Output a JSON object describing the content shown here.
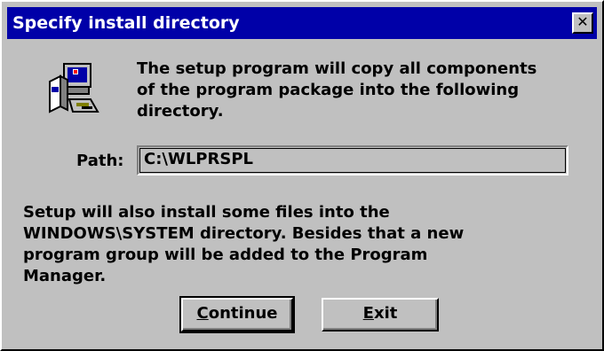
{
  "window": {
    "title": "Specify install directory",
    "close_glyph": "✕"
  },
  "icons": {
    "setup": "setup-computer-icon",
    "close": "close-icon"
  },
  "intro": {
    "line1": "The setup program will copy all components",
    "line2": "of the program package into the following",
    "line3": "directory."
  },
  "path": {
    "label": "Path:",
    "value": "C:\\WLPRSPL"
  },
  "info": {
    "line1": "Setup will also install some files into the",
    "line2": "WINDOWS\\SYSTEM directory. Besides that a new",
    "line3": "program group will be added to the Program",
    "line4": "Manager."
  },
  "buttons": {
    "continue_mnemonic": "C",
    "continue_rest": "ontinue",
    "exit_mnemonic": "E",
    "exit_rest": "xit"
  },
  "colors": {
    "titlebar": "#0000a8",
    "face": "#c0c0c0"
  }
}
